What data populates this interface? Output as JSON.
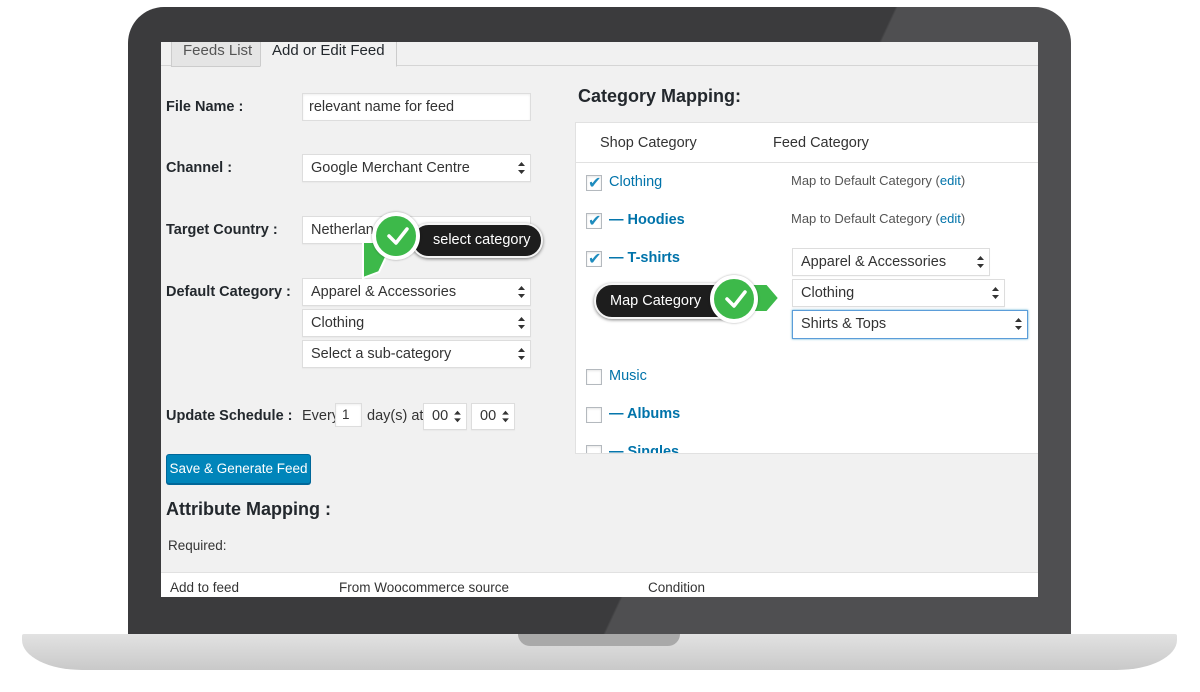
{
  "tabs": [
    "Feeds List",
    "Add or Edit Feed"
  ],
  "form": {
    "file_name_label": "File Name :",
    "file_name_value": "relevant name for feed",
    "channel_label": "Channel :",
    "channel_value": "Google Merchant Centre",
    "target_country_label": "Target Country :",
    "target_country_value": "Netherlan",
    "default_category_label": "Default Category :",
    "default_category_values": [
      "Apparel & Accessories",
      "Clothing",
      "Select a sub-category"
    ],
    "update_schedule_label": "Update Schedule :",
    "every_text": "Every",
    "every_value": "1",
    "days_at_text": "day(s) at",
    "hour_value": "00",
    "minute_value": "00"
  },
  "save_button": "Save & Generate Feed",
  "attribute_mapping": {
    "title": "Attribute Mapping :",
    "required_label": "Required:",
    "columns": [
      "Add to feed",
      "From Woocommerce source",
      "Condition"
    ]
  },
  "category_mapping": {
    "title": "Category Mapping:",
    "columns": [
      "Shop Category",
      "Feed Category"
    ],
    "rows": [
      {
        "name": "Clothing",
        "checked": true,
        "map_text": "Map to Default Category (",
        "edit": "edit",
        "close": ")"
      },
      {
        "name": "— Hoodies",
        "checked": true,
        "map_text": "Map to Default Category (",
        "edit": "edit",
        "close": ")"
      },
      {
        "name": "— T-shirts",
        "checked": true
      },
      {
        "name": "Music",
        "checked": false
      },
      {
        "name": "— Albums",
        "checked": false
      },
      {
        "name": "— Singles",
        "checked": false
      }
    ],
    "tshirt_selects": [
      "Apparel & Accessories",
      "Clothing",
      "Shirts & Tops"
    ]
  },
  "callouts": {
    "select_category": "select category",
    "map_category": "Map Category"
  },
  "colors": {
    "button_blue": "#0085ba",
    "link_blue": "#0073aa",
    "badge_green": "#3db94a",
    "callout_dark": "#1d1d1d"
  }
}
